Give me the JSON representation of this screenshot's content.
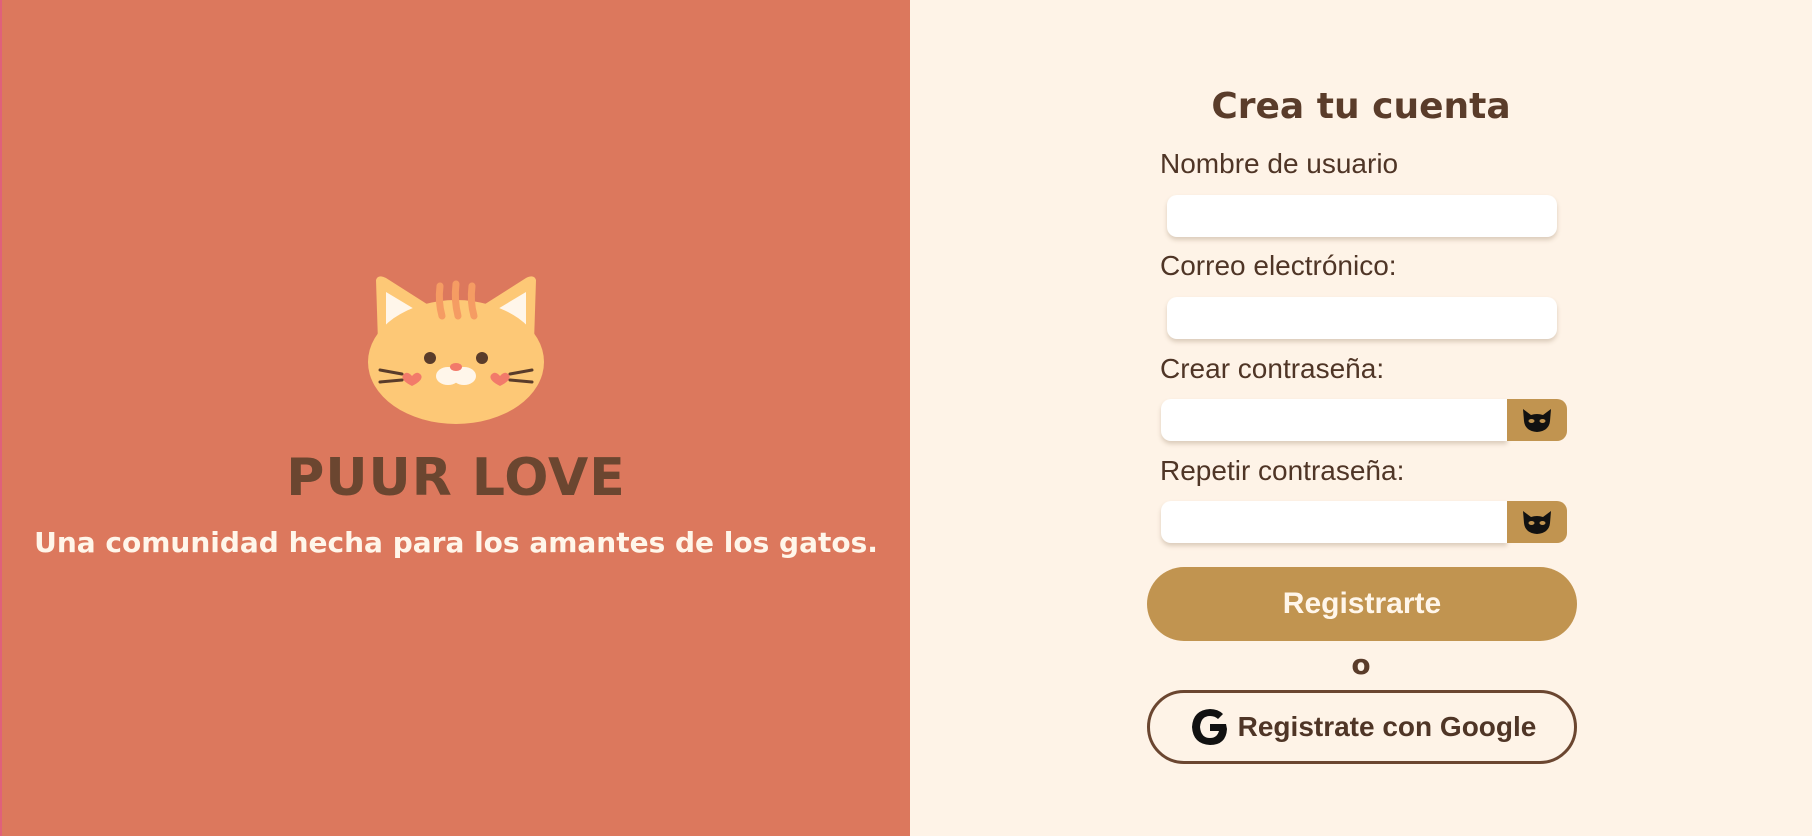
{
  "brand": {
    "name": "PUUR LOVE",
    "tagline": "Una comunidad hecha para los amantes de los gatos.",
    "logo_icon": "cat-face-icon"
  },
  "form": {
    "title": "Crea tu cuenta",
    "username_label": "Nombre de usuario",
    "email_label": "Correo electrónico:",
    "password_label": "Crear contraseña:",
    "repeat_password_label": "Repetir contraseña:",
    "username_value": "",
    "email_value": "",
    "password_value": "",
    "repeat_password_value": "",
    "toggle_icon": "cat-mask-icon",
    "submit_label": "Registrarte",
    "or_label": "o",
    "google_label": "Registrate con Google",
    "google_icon": "google-g-icon"
  },
  "colors": {
    "left_bg": "#dc785d",
    "right_bg": "#fef3e7",
    "brand_brown": "#6b4630",
    "accent_gold": "#c19450"
  }
}
